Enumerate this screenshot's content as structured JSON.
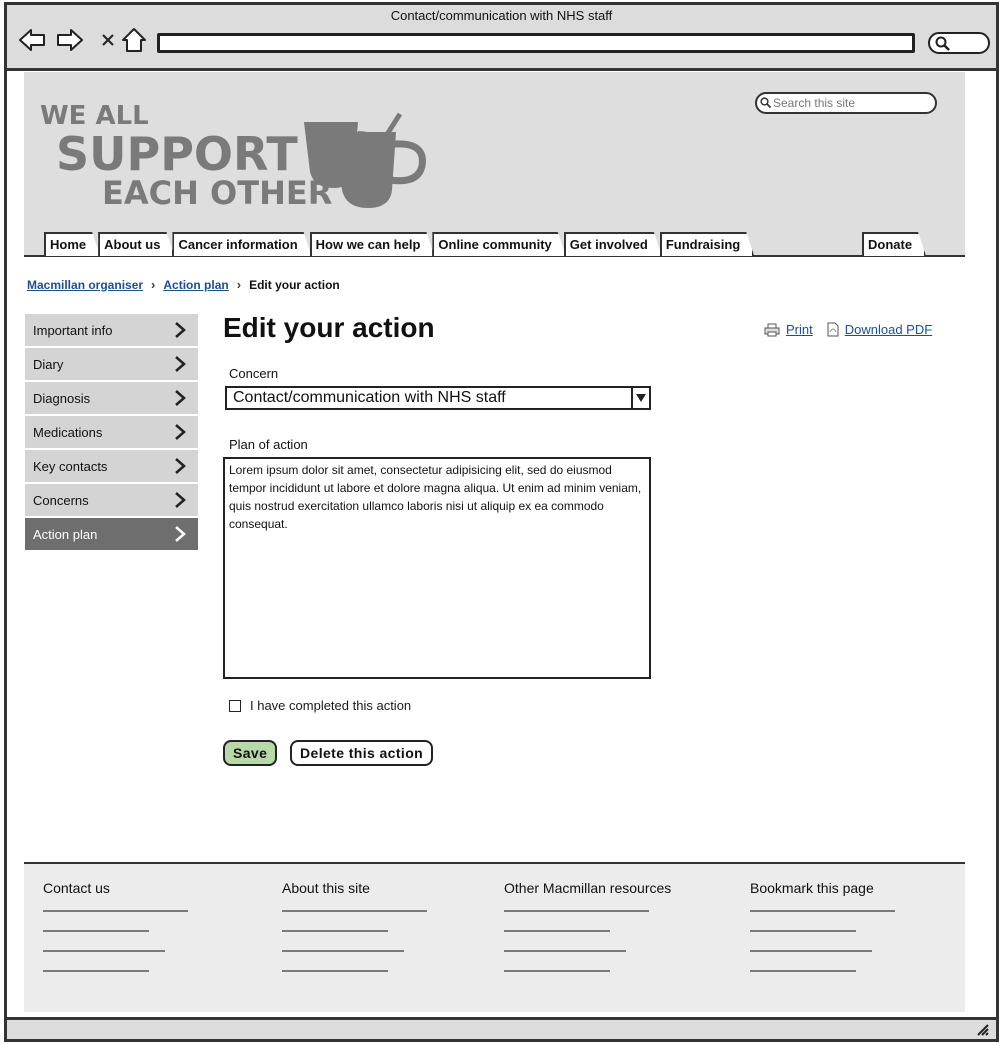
{
  "browser": {
    "title": "Contact/communication with NHS staff"
  },
  "header": {
    "logo_lines": [
      "WE ALL",
      "SUPPORT",
      "EACH OTHER"
    ],
    "search_placeholder": "Search this site",
    "tabs": [
      "Home",
      "About us",
      "Cancer information",
      "How we can help",
      "Online community",
      "Get involved",
      "Fundraising"
    ],
    "donate_label": "Donate"
  },
  "breadcrumb": {
    "items": [
      "Macmillan organiser",
      "Action plan"
    ],
    "current": "Edit your action"
  },
  "sidebar": {
    "items": [
      "Important info",
      "Diary",
      "Diagnosis",
      "Medications",
      "Key contacts",
      "Concerns",
      "Action plan"
    ],
    "active_index": 6
  },
  "main": {
    "title": "Edit your action",
    "print_label": "Print",
    "download_label": "Download PDF",
    "concern_label": "Concern",
    "concern_value": "Contact/communication with NHS staff",
    "plan_label": "Plan of action",
    "plan_text": "Lorem ipsum dolor sit amet, consectetur adipisicing elit, sed do eiusmod tempor incididunt ut labore et dolore magna aliqua. Ut enim ad minim veniam, quis nostrud exercitation ullamco laboris nisi ut aliquip ex ea commodo consequat.",
    "completed_label": "I have completed this action",
    "save_label": "Save",
    "delete_label": "Delete this action"
  },
  "footer": {
    "columns": [
      "Contact us",
      "About this site",
      "Other Macmillan resources",
      "Bookmark this page"
    ]
  },
  "colors": {
    "save_button": "#b7d8a7",
    "link": "#1f4e8c",
    "active_sidebar": "#6e6e6e",
    "logo": "#7a7a7a"
  }
}
